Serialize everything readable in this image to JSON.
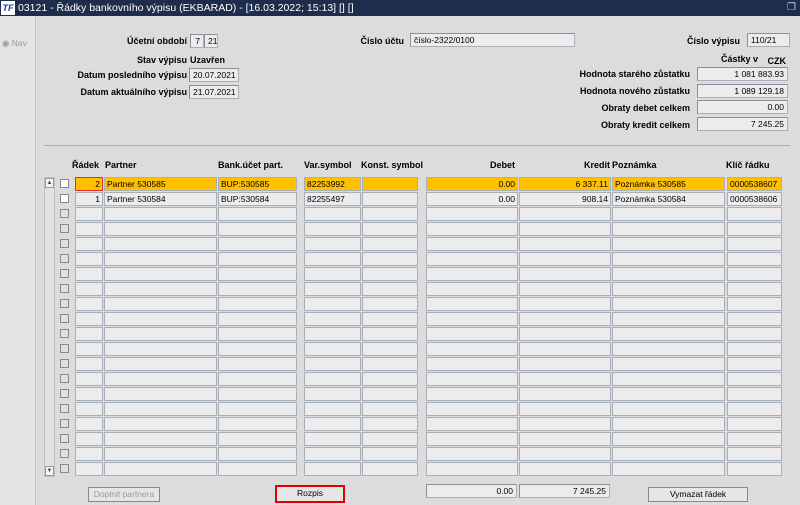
{
  "title": "03121 - Řádky bankovního výpisu (EKBARAD) - [16.03.2022; 15:13]  [] []",
  "logo": "TF",
  "nav": "Nav",
  "header": {
    "ucetni_obdobi_label": "Účetní období",
    "ucetni_obdobi_month": "7",
    "ucetni_obdobi_year": "21",
    "stav_label": "Stav výpisu",
    "stav_value": "Uzavřen",
    "datum_posl_label": "Datum posledního výpisu",
    "datum_posl_value": "20.07.2021",
    "datum_akt_label": "Datum aktuálního výpisu",
    "datum_akt_value": "21.07.2021",
    "cislo_uctu_label": "Číslo účtu",
    "cislo_uctu_value": "číslo-2322/0100",
    "cislo_vypisu_label": "Číslo výpisu",
    "cislo_vypisu_value": "110/21",
    "castky_label": "Částky v",
    "currency": "CZK",
    "stary_label": "Hodnota starého zůstatku",
    "stary_value": "1 081 883.93",
    "novy_label": "Hodnota nového zůstatku",
    "novy_value": "1 089 129.18",
    "debet_label": "Obraty debet celkem",
    "debet_value": "0.00",
    "kredit_label": "Obraty kredit celkem",
    "kredit_value": "7 245.25"
  },
  "columns": {
    "radek": "Řádek",
    "partner": "Partner",
    "bank": "Bank.účet part.",
    "var": "Var.symbol",
    "konst": "Konst. symbol",
    "debet": "Debet",
    "kredit": "Kredit",
    "poznamka": "Poznámka",
    "klic": "Klíč řádku"
  },
  "rows": [
    {
      "radek": "2",
      "partner": "Partner 530585",
      "bank": "BUP:530585",
      "var": "82253992",
      "konst": "",
      "debet": "0.00",
      "kredit": "6 337.11",
      "poznamka": "Poznámka 530585",
      "klic": "0000538607",
      "selected": true
    },
    {
      "radek": "1",
      "partner": "Partner 530584",
      "bank": "BUP:530584",
      "var": "82255497",
      "konst": "",
      "debet": "0.00",
      "kredit": "908.14",
      "poznamka": "Poznámka 530584",
      "klic": "0000538606",
      "selected": false
    }
  ],
  "empty_rows": 18,
  "footer": {
    "doplnit": "Doplnit partnera",
    "rozpis": "Rozpis",
    "sum_debet": "0.00",
    "sum_kredit": "7 245.25",
    "vymazat": "Vymazat řádek"
  }
}
